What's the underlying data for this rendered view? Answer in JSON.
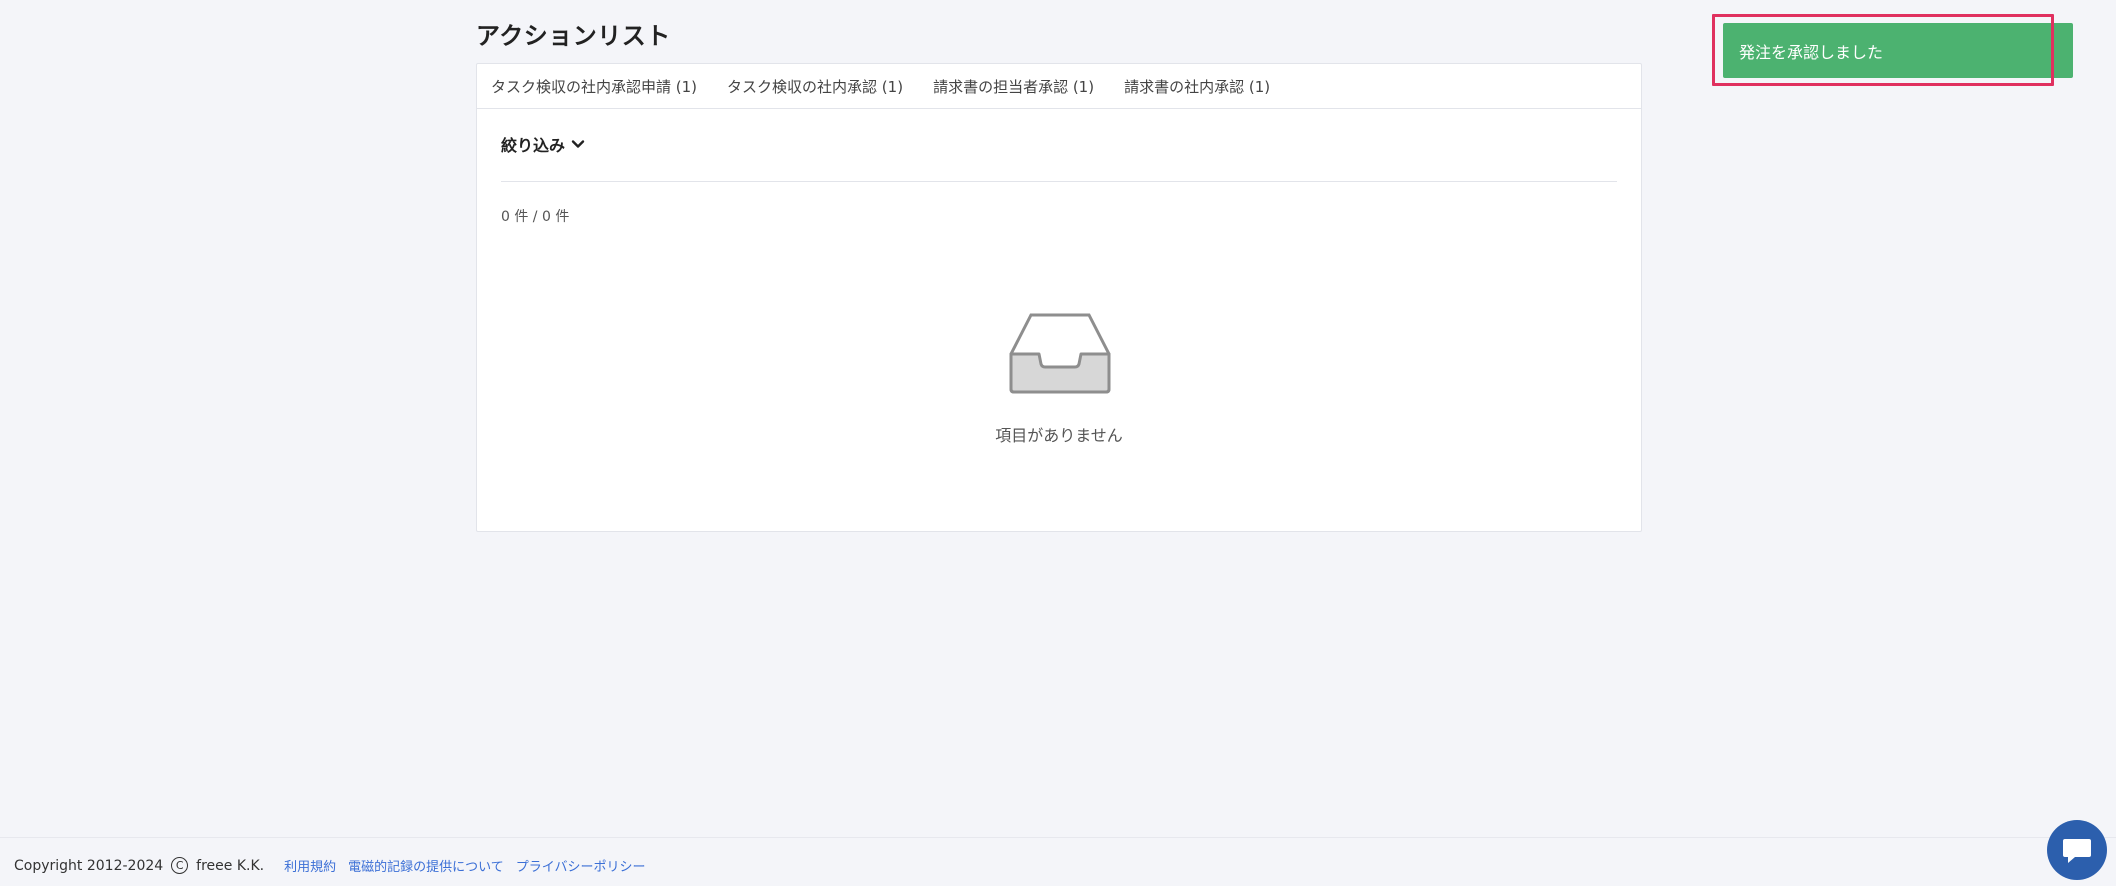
{
  "page": {
    "title": "アクションリスト"
  },
  "tabs": [
    {
      "label": "タスク検収の社内承認申請 (1)"
    },
    {
      "label": "タスク検収の社内承認 (1)"
    },
    {
      "label": "請求書の担当者承認 (1)"
    },
    {
      "label": "請求書の社内承認 (1)"
    }
  ],
  "filter": {
    "label": "絞り込み",
    "icon": "chevron-down-icon"
  },
  "results": {
    "count_text": "0 件 / 0 件",
    "empty_text": "項目がありません",
    "empty_icon": "inbox-tray-icon"
  },
  "toast": {
    "message": "発注を承認しました",
    "color": "#4cb270"
  },
  "highlight": {
    "color": "#e0305f"
  },
  "footer": {
    "copyright": "Copyright 2012-2024",
    "copyright_symbol": "C",
    "company": "freee K.K.",
    "links": [
      {
        "label": "利用規約"
      },
      {
        "label": "電磁的記録の提供について"
      },
      {
        "label": "プライバシーポリシー"
      }
    ]
  },
  "chat": {
    "icon": "chat-bubble-icon",
    "color": "#2c5fad"
  }
}
